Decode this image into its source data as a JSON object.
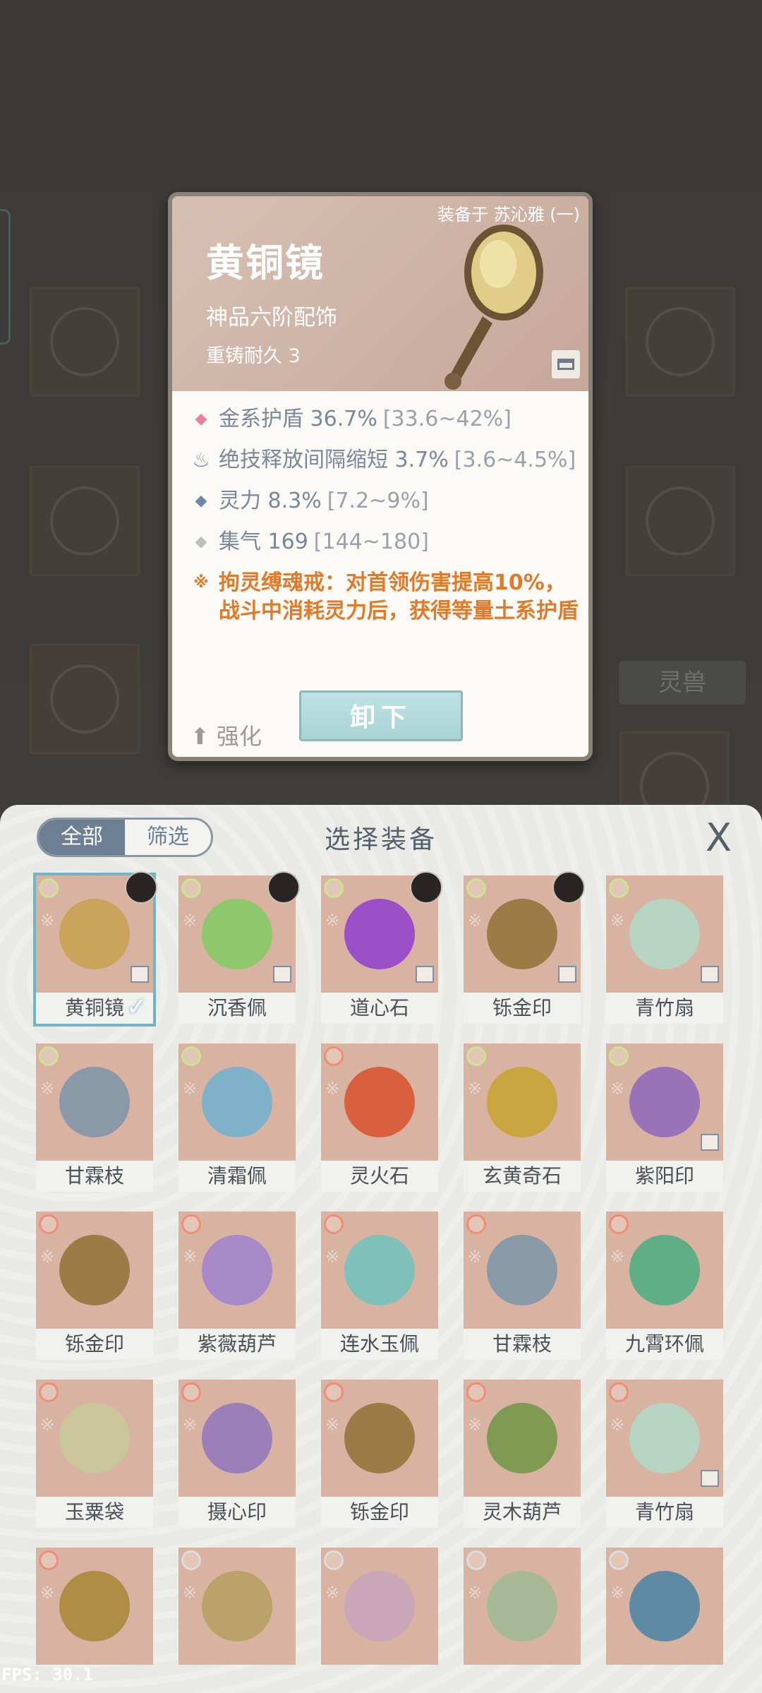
{
  "background": {
    "tab_label": "灵兽"
  },
  "detail": {
    "equipped_on": "装备于 苏沁雅 (一)",
    "name": "黄铜镜",
    "grade": "神品六阶配饰",
    "reforge": "重铸耐久 3",
    "stats": [
      {
        "icon": "diamond-pink-icon",
        "color": "#e97fa1",
        "text": "金系护盾 36.7%",
        "range": "[33.6~42%]"
      },
      {
        "icon": "flame-icon",
        "color": "#6e8aa8",
        "text": "绝技释放间隔缩短 3.7%",
        "range": "[3.6~4.5%]"
      },
      {
        "icon": "diamond-blue-icon",
        "color": "#6e8aa8",
        "text": "灵力 8.3%",
        "range": "[7.2~9%]"
      },
      {
        "icon": "diamond-grey-icon",
        "color": "#bdbdbd",
        "text": "集气 169",
        "range": "[144~180]"
      }
    ],
    "special": "拘灵缚魂戒：对首领伤害提高10%，战斗中消耗灵力后，获得等量土系护盾",
    "enhance_label": "强化",
    "unequip_label": "卸下"
  },
  "panel": {
    "filter_all": "全部",
    "filter_select": "筛选",
    "title": "选择装备",
    "close": "X",
    "items": [
      {
        "name": "黄铜镜",
        "element": "green",
        "selected": true,
        "owner": true,
        "tag": true,
        "color": "#c9a45a"
      },
      {
        "name": "沉香佩",
        "element": "green",
        "owner": true,
        "tag": true,
        "color": "#8fc76d"
      },
      {
        "name": "道心石",
        "element": "green",
        "owner": true,
        "tag": true,
        "color": "#9a4fc7"
      },
      {
        "name": "铄金印",
        "element": "green",
        "owner": true,
        "tag": true,
        "color": "#9c7b47"
      },
      {
        "name": "青竹扇",
        "element": "green",
        "tag": true,
        "color": "#b7d3c2"
      },
      {
        "name": "甘霖枝",
        "element": "green",
        "color": "#8a99a8"
      },
      {
        "name": "清霜佩",
        "element": "green",
        "color": "#7fb1c9"
      },
      {
        "name": "灵火石",
        "element": "red",
        "color": "#d9603f"
      },
      {
        "name": "玄黄奇石",
        "element": "green",
        "color": "#c9a43f"
      },
      {
        "name": "紫阳印",
        "element": "green",
        "tag": true,
        "color": "#9a72b8"
      },
      {
        "name": "铄金印",
        "element": "red",
        "color": "#9c7b47"
      },
      {
        "name": "紫薇葫芦",
        "element": "red",
        "color": "#a98ac9"
      },
      {
        "name": "连水玉佩",
        "element": "red",
        "color": "#7fc0b8"
      },
      {
        "name": "甘霖枝",
        "element": "red",
        "color": "#8a99a8"
      },
      {
        "name": "九霄环佩",
        "element": "red",
        "color": "#5fae86"
      },
      {
        "name": "玉粟袋",
        "element": "red",
        "color": "#c9c69a"
      },
      {
        "name": "摄心印",
        "element": "red",
        "color": "#9c7fb8"
      },
      {
        "name": "铄金印",
        "element": "red",
        "color": "#9c7b47"
      },
      {
        "name": "灵木葫芦",
        "element": "red",
        "color": "#7f9a52"
      },
      {
        "name": "青竹扇",
        "element": "red",
        "tag": true,
        "color": "#b7d3c2"
      },
      {
        "name": "",
        "element": "red",
        "color": "#b08d45"
      },
      {
        "name": "",
        "element": "grey",
        "color": "#b9a36a"
      },
      {
        "name": "",
        "element": "grey",
        "color": "#c9a6b8"
      },
      {
        "name": "",
        "element": "grey",
        "color": "#a7b896"
      },
      {
        "name": "",
        "element": "grey",
        "color": "#5f8aa3"
      }
    ]
  },
  "fps": "FPS: 30.1"
}
